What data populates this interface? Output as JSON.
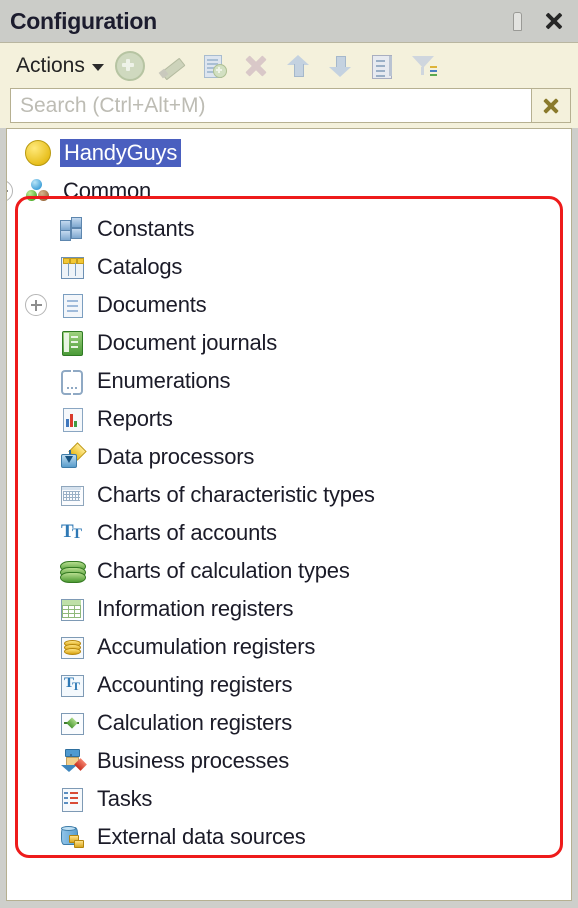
{
  "window": {
    "title": "Configuration",
    "pin_icon": "pin-icon",
    "close_icon": "close-icon"
  },
  "toolbar": {
    "actions_label": "Actions",
    "buttons": [
      {
        "name": "add-button",
        "icon": "add-icon"
      },
      {
        "name": "edit-button",
        "icon": "pencil-icon"
      },
      {
        "name": "copy-button",
        "icon": "copy-icon"
      },
      {
        "name": "delete-button",
        "icon": "delete-x-icon"
      },
      {
        "name": "move-up-button",
        "icon": "arrow-up-icon"
      },
      {
        "name": "move-down-button",
        "icon": "arrow-down-icon"
      },
      {
        "name": "properties-button",
        "icon": "list-properties-icon"
      },
      {
        "name": "filter-button",
        "icon": "filter-funnel-icon"
      }
    ]
  },
  "search": {
    "placeholder": "Search (Ctrl+Alt+M)",
    "value": "",
    "clear_icon": "close-x-icon"
  },
  "tree": {
    "items": [
      {
        "label": "HandyGuys",
        "icon": "yellow-sphere-icon",
        "indent": 0,
        "expander": "none",
        "selected": true
      },
      {
        "label": "Common",
        "icon": "common-spheres-icon",
        "indent": 0,
        "expander": "collapsed",
        "selected": false
      },
      {
        "label": "Constants",
        "icon": "constants-icon",
        "indent": 1,
        "expander": "none",
        "selected": false
      },
      {
        "label": "Catalogs",
        "icon": "catalogs-icon",
        "indent": 1,
        "expander": "none",
        "selected": false
      },
      {
        "label": "Documents",
        "icon": "documents-icon",
        "indent": 1,
        "expander": "collapsed",
        "selected": false
      },
      {
        "label": "Document journals",
        "icon": "document-journals-icon",
        "indent": 1,
        "expander": "none",
        "selected": false
      },
      {
        "label": "Enumerations",
        "icon": "enumerations-icon",
        "indent": 1,
        "expander": "none",
        "selected": false
      },
      {
        "label": "Reports",
        "icon": "reports-icon",
        "indent": 1,
        "expander": "none",
        "selected": false
      },
      {
        "label": "Data processors",
        "icon": "data-processors-icon",
        "indent": 1,
        "expander": "none",
        "selected": false
      },
      {
        "label": "Charts of characteristic types",
        "icon": "charts-characteristic-icon",
        "indent": 1,
        "expander": "none",
        "selected": false
      },
      {
        "label": "Charts of accounts",
        "icon": "charts-accounts-icon",
        "indent": 1,
        "expander": "none",
        "selected": false
      },
      {
        "label": "Charts of calculation types",
        "icon": "charts-calculation-icon",
        "indent": 1,
        "expander": "none",
        "selected": false
      },
      {
        "label": "Information registers",
        "icon": "information-registers-icon",
        "indent": 1,
        "expander": "none",
        "selected": false
      },
      {
        "label": "Accumulation registers",
        "icon": "accumulation-registers-icon",
        "indent": 1,
        "expander": "none",
        "selected": false
      },
      {
        "label": "Accounting registers",
        "icon": "accounting-registers-icon",
        "indent": 1,
        "expander": "none",
        "selected": false
      },
      {
        "label": "Calculation registers",
        "icon": "calculation-registers-icon",
        "indent": 1,
        "expander": "none",
        "selected": false
      },
      {
        "label": "Business processes",
        "icon": "business-processes-icon",
        "indent": 1,
        "expander": "none",
        "selected": false
      },
      {
        "label": "Tasks",
        "icon": "tasks-icon",
        "indent": 1,
        "expander": "none",
        "selected": false
      },
      {
        "label": "External data sources",
        "icon": "external-data-sources-icon",
        "indent": 1,
        "expander": "none",
        "selected": false
      }
    ]
  },
  "annotation": {
    "shape": "rounded-rectangle",
    "color": "#ee1b1b",
    "covers_from": "Constants",
    "covers_to": "External data sources"
  },
  "colors": {
    "titlebar_bg": "#cbccc8",
    "toolbar_bg": "#f4f1dc",
    "tree_bg": "#ffffff",
    "selection_bg": "#4a5fbf",
    "annotation": "#ee1b1b",
    "text": "#1b1b28"
  }
}
